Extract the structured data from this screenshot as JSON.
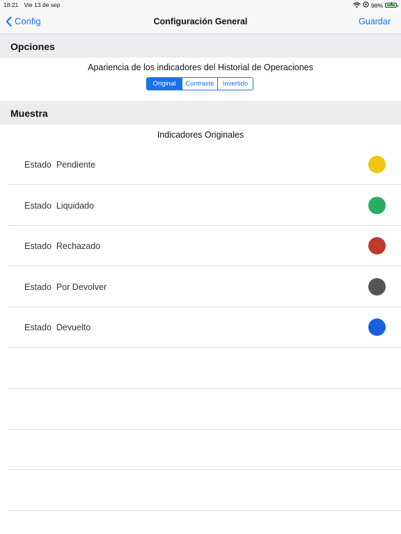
{
  "status_bar": {
    "time": "18:21",
    "date": "Vie 13 de sep",
    "battery_percent": "98%",
    "battery_level": 0.98,
    "icons": [
      "wifi-icon",
      "location-icon",
      "battery-icon"
    ]
  },
  "nav": {
    "back_label": "Config",
    "title": "Configuración General",
    "save_label": "Guardar",
    "accent_color": "#1a73e8"
  },
  "options": {
    "header": "Opciones",
    "label": "Apariencia de los indicadores del Historial de Operaciones",
    "segments": [
      "Original",
      "Contraste",
      "Invertido"
    ],
    "selected_index": 0
  },
  "sample": {
    "header": "Muestra",
    "title": "Indicadores Originales",
    "rows": [
      {
        "label": "Estado  Pendiente",
        "color": "#f1c40f"
      },
      {
        "label": "Estado  Liquidado",
        "color": "#27ae60"
      },
      {
        "label": "Estado  Rechazado",
        "color": "#c0392b"
      },
      {
        "label": "Estado  Por Devolver",
        "color": "#555555"
      },
      {
        "label": "Estado  Devuelto",
        "color": "#1a5fe0"
      }
    ]
  }
}
